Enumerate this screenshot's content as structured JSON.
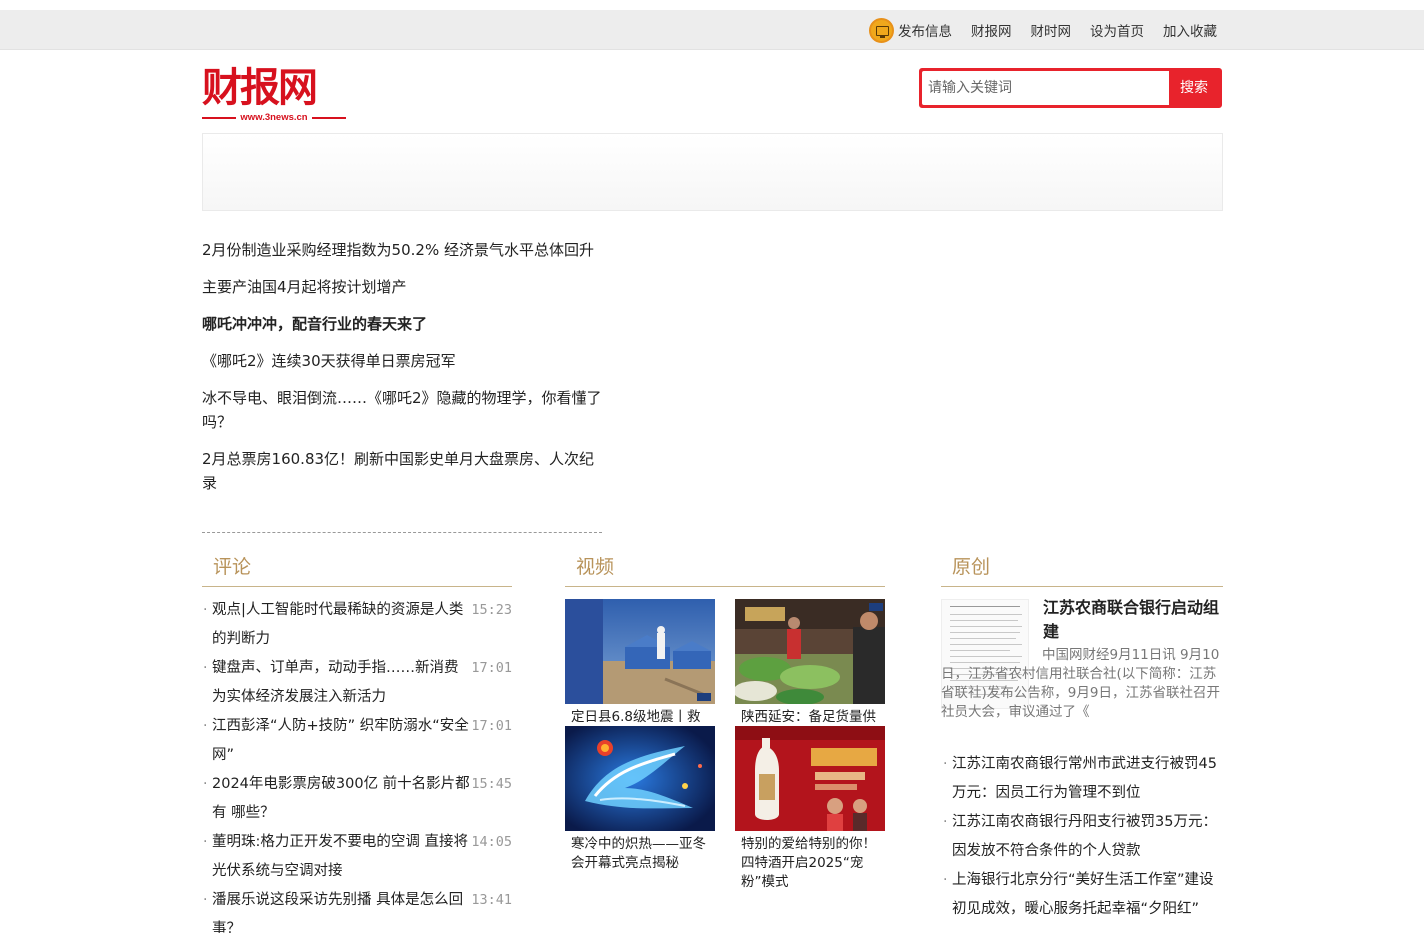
{
  "topbar": {
    "publish": "发布信息",
    "links": [
      "财报网",
      "财时网",
      "设为首页",
      "加入收藏"
    ]
  },
  "logo": {
    "name": "财报网",
    "url": "www.3news.cn"
  },
  "search": {
    "placeholder": "请输入关键词",
    "button": "搜索"
  },
  "headlines": [
    "2月份制造业采购经理指数为50.2% 经济景气水平总体回升",
    "主要产油国4月起将按计划增产",
    "哪吒冲冲冲，配音行业的春天来了",
    "《哪吒2》连续30天获得单日票房冠军",
    "冰不导电、眼泪倒流……《哪吒2》隐藏的物理学，你看懂了吗？",
    "2月总票房160.83亿！刷新中国影史单月大盘票房、人次纪录"
  ],
  "sections": {
    "comment": "评论",
    "video": "视频",
    "original": "原创"
  },
  "comments": [
    {
      "title": "观点|人工智能时代最稀缺的资源是人类的判断力",
      "time": "15:23"
    },
    {
      "title": "键盘声、订单声，动动手指……新消费为实体经济发展注入新活力",
      "time": "17:01"
    },
    {
      "title": "江西彭泽“人防+技防” 织牢防溺水“安全网”",
      "time": "17:01"
    },
    {
      "title": "2024年电影票房破300亿 前十名影片都有 哪些？",
      "time": "15:45"
    },
    {
      "title": "董明珠:格力正开发不要电的空调 直接将光伏系统与空调对接",
      "time": "14:05"
    },
    {
      "title": "潘展乐说这段采访先别播 具体是怎么回事？",
      "time": "13:41"
    }
  ],
  "videos": [
    {
      "caption": "定日县6.8级地震丨救"
    },
    {
      "caption": "陕西延安：备足货量供"
    },
    {
      "caption": "寒冷中的炽热——亚冬会开幕式亮点揭秘"
    },
    {
      "caption": "特别的爱给特别的你！四特酒开启2025“宠粉”模式"
    }
  ],
  "original": {
    "title": "江苏农商联合银行启动组建",
    "desc": "中国网财经9月11日讯 9月10日，江苏省农村信用社联合社(以下简称：江苏省联社)发布公告称，9月9日，江苏省联社召开社员大会，审议通过了《",
    "items": [
      "江苏江南农商银行常州市武进支行被罚45万元：因员工行为管理不到位",
      "江苏江南农商银行丹阳支行被罚35万元：因发放不符合条件的个人贷款",
      "上海银行北京分行“美好生活工作室”建设初见成效，暖心服务托起幸福“夕阳红”"
    ]
  },
  "colors": {
    "brand_red": "#d7111e",
    "search_red": "#e8232c",
    "section_gold": "#b8935a"
  }
}
